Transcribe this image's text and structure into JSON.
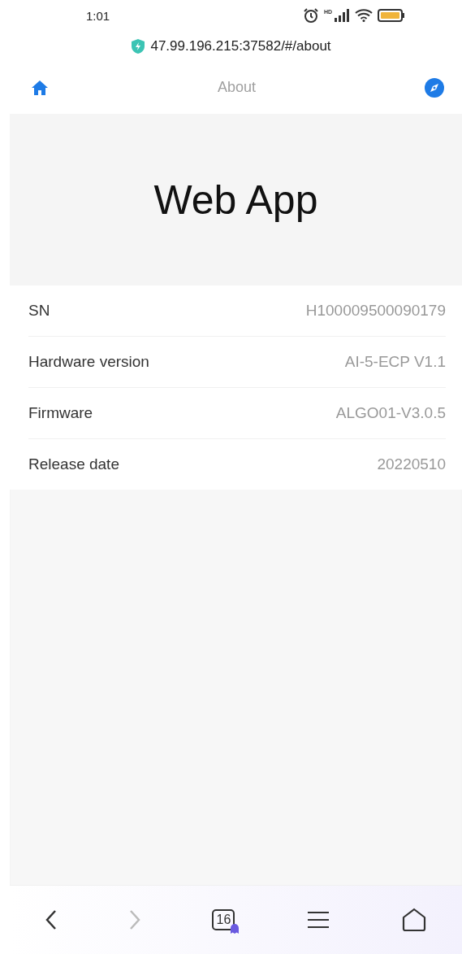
{
  "status_bar": {
    "time": "1:01",
    "network_badge": "HD"
  },
  "address_bar": {
    "url": "47.99.196.215:37582/#/about"
  },
  "nav_bar": {
    "title": "About"
  },
  "hero": {
    "title": "Web App"
  },
  "info_rows": [
    {
      "label": "SN",
      "value": "H100009500090179"
    },
    {
      "label": "Hardware version",
      "value": "AI-5-ECP V1.1"
    },
    {
      "label": "Firmware",
      "value": "ALGO01-V3.0.5"
    },
    {
      "label": "Release date",
      "value": "20220510"
    }
  ],
  "browser_toolbar": {
    "back_disabled": false,
    "forward_disabled": true,
    "tab_count": "16"
  }
}
